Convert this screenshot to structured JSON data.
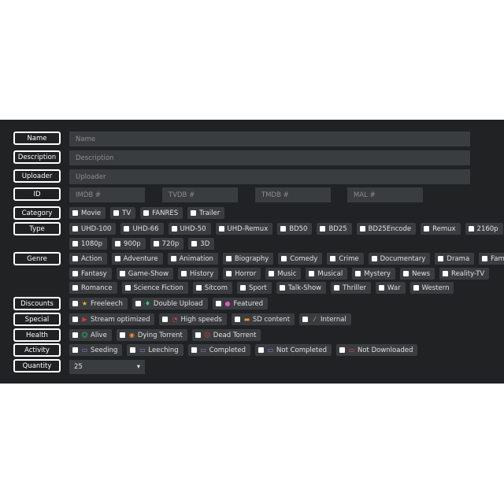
{
  "labels": {
    "name": "Name",
    "description": "Description",
    "uploader": "Uploader",
    "id": "ID",
    "category": "Category",
    "type": "Type",
    "genre": "Genre",
    "discounts": "Discounts",
    "special": "Special",
    "health": "Health",
    "activity": "Activity",
    "quantity": "Quantity"
  },
  "inputs": {
    "name_placeholder": "Name",
    "description_placeholder": "Description",
    "uploader_placeholder": "Uploader",
    "imdb_placeholder": "IMDB #",
    "tvdb_placeholder": "TVDB #",
    "tmdb_placeholder": "TMDB #",
    "mal_placeholder": "MAL #"
  },
  "category": [
    "Movie",
    "TV",
    "FANRES",
    "Trailer"
  ],
  "type_row1": [
    "UHD-100",
    "UHD-66",
    "UHD-50",
    "UHD-Remux",
    "BD50",
    "BD25",
    "BD25Encode",
    "Remux",
    "2160p"
  ],
  "type_row2": [
    "1080p",
    "900p",
    "720p",
    "3D"
  ],
  "genre_row1": [
    "Action",
    "Adventure",
    "Animation",
    "Biography",
    "Comedy",
    "Crime",
    "Documentary",
    "Drama",
    "Family"
  ],
  "genre_row2": [
    "Fantasy",
    "Game-Show",
    "History",
    "Horror",
    "Music",
    "Musical",
    "Mystery",
    "News",
    "Reality-TV"
  ],
  "genre_row3": [
    "Romance",
    "Science Fiction",
    "Sitcom",
    "Sport",
    "Talk-Show",
    "Thriller",
    "War",
    "Western"
  ],
  "discounts": [
    {
      "label": "Freeleech",
      "icon": "star-icon",
      "color": "#f5b324"
    },
    {
      "label": "Double Upload",
      "icon": "gem-icon",
      "color": "#2ecc71"
    },
    {
      "label": "Featured",
      "icon": "circle-icon",
      "color": "#e056c8"
    }
  ],
  "special": [
    {
      "label": "Stream optimized",
      "icon": "play-icon",
      "color": "#e03c3c"
    },
    {
      "label": "High speeds",
      "icon": "speedometer-icon",
      "color": "#e03c3c"
    },
    {
      "label": "SD content",
      "icon": "sd-card-icon",
      "color": "#f08c2c"
    },
    {
      "label": "Internal",
      "icon": "magic-wand-icon",
      "color": "#9bd14a"
    }
  ],
  "health": [
    {
      "label": "Alive",
      "icon": "smile-icon",
      "color": "#2ecc71"
    },
    {
      "label": "Dying Torrent",
      "icon": "meh-icon",
      "color": "#f08c2c"
    },
    {
      "label": "Dead Torrent",
      "icon": "frown-icon",
      "color": "#e03c3c"
    }
  ],
  "activity": [
    {
      "label": "Seeding",
      "icon": "hdd-icon",
      "color": "#9b7be0"
    },
    {
      "label": "Leeching",
      "icon": "hdd-icon",
      "color": "#9b7be0"
    },
    {
      "label": "Completed",
      "icon": "hdd-icon",
      "color": "#9b7be0"
    },
    {
      "label": "Not Completed",
      "icon": "hdd-icon",
      "color": "#9b7be0"
    },
    {
      "label": "Not Downloaded",
      "icon": "hdd-icon",
      "color": "#e05656"
    }
  ],
  "quantity": {
    "value": "25",
    "arrow": "▾"
  }
}
